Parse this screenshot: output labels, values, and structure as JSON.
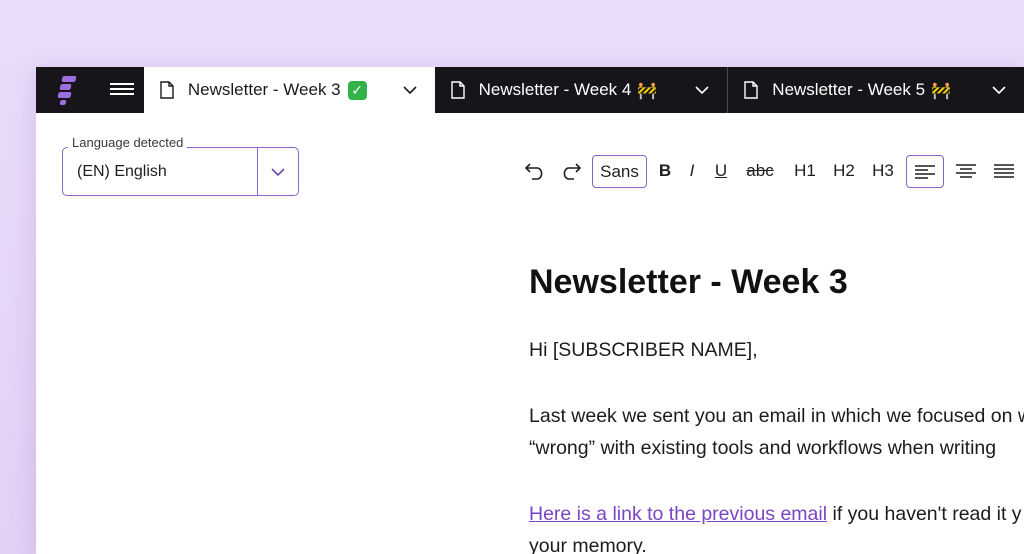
{
  "tabs": [
    {
      "label": "Newsletter - Week 3",
      "status_icon": "check-mark-emoji",
      "active": true
    },
    {
      "label": "Newsletter - Week 4",
      "status_icon": "construction-emoji",
      "active": false
    },
    {
      "label": "Newsletter - Week 5",
      "status_icon": "construction-emoji",
      "active": false
    }
  ],
  "language": {
    "legend": "Language detected",
    "value": "(EN)  English"
  },
  "toolbar": {
    "font_label": "Sans",
    "bold": "B",
    "italic": "I",
    "underline": "U",
    "strike": "abc",
    "h1": "H1",
    "h2": "H2",
    "h3": "H3"
  },
  "document": {
    "title": "Newsletter - Week 3",
    "greeting": "Hi [SUBSCRIBER NAME],",
    "para1_line1": "Last week we sent you an email in which we focused on w",
    "para1_line2": "“wrong” with existing tools and workflows when writing",
    "link_text": "Here is a link to the previous email",
    "para2_rest": " if you haven't read it y",
    "para2_line2": "your memory."
  },
  "colors": {
    "accent": "#8d62c9",
    "link": "#7b45c4",
    "tabbar": "#17151a",
    "background": "#e7d6f7"
  }
}
